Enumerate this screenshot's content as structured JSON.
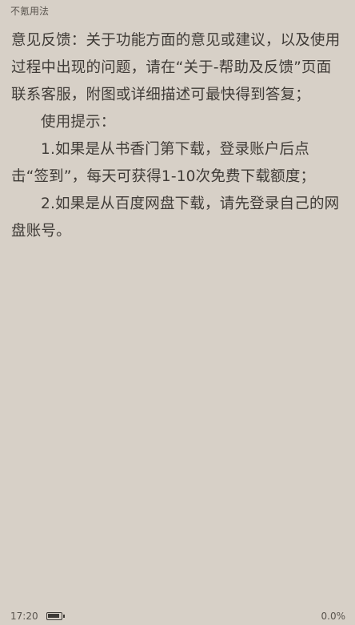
{
  "header": {
    "chapter_title": "不氪用法"
  },
  "content": {
    "paragraphs": [
      "意见反馈：关于功能方面的意见或建议，以及使用过程中出现的问题，请在“关于-帮助及反馈”页面联系客服，附图或详细描述可最快得到答复；",
      "使用提示：",
      "1.如果是从书香门第下载，登录账户后点击“签到”，每天可获得1-10次免费下载额度；",
      "2.如果是从百度网盘下载，请先登录自己的网盘账号。"
    ]
  },
  "status_bar": {
    "time": "17:20",
    "battery_level": 0.9,
    "read_progress": "0.0%"
  },
  "colors": {
    "background": "#d7d0c7",
    "text": "#3f3b37"
  },
  "icons": {
    "battery": "battery-icon"
  }
}
